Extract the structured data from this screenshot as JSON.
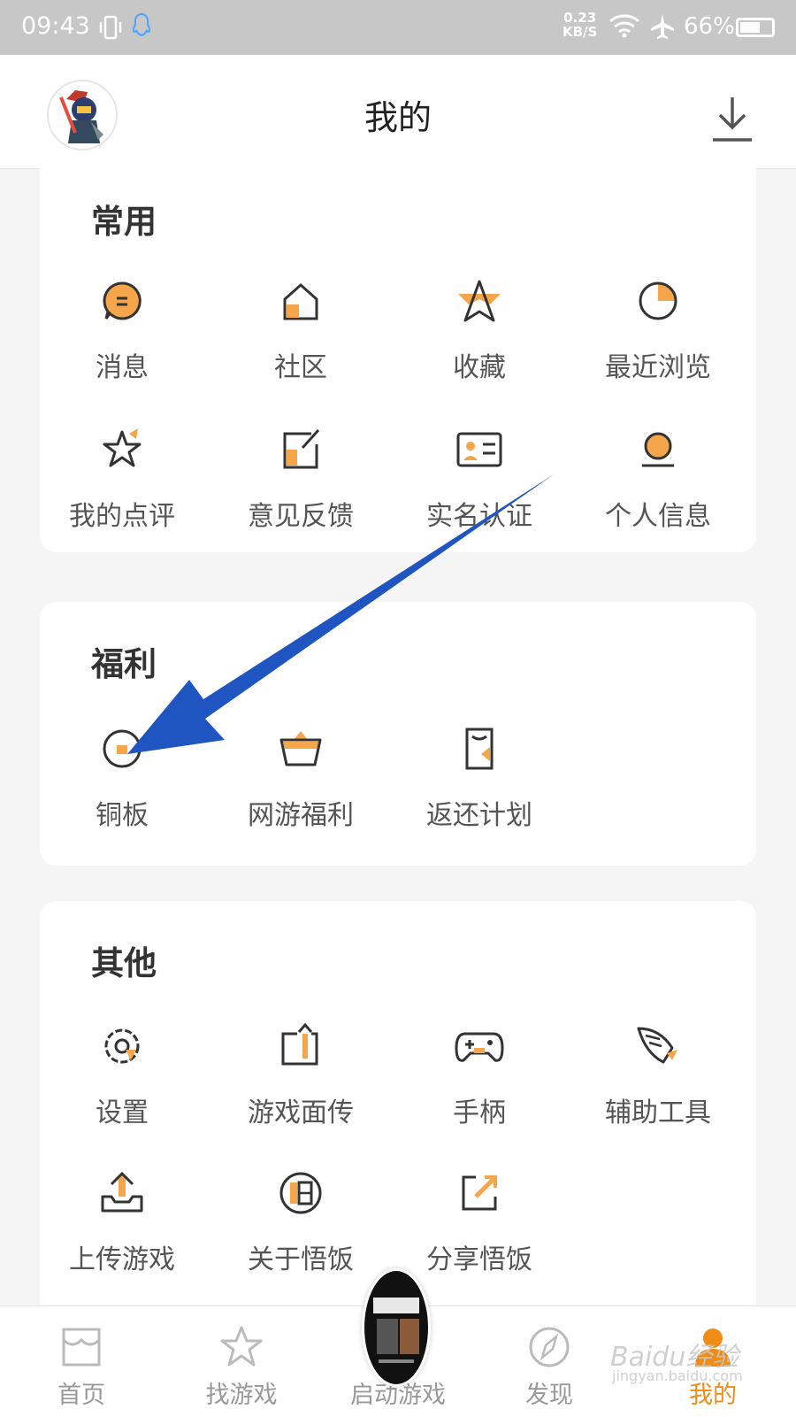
{
  "status_bar": {
    "time": "09:43",
    "speed_value": "0.23",
    "speed_unit": "KB/S",
    "battery": "66%",
    "battery_level": 0.66
  },
  "header": {
    "title": "我的"
  },
  "sections": {
    "common": {
      "title": "常用",
      "items": [
        "消息",
        "社区",
        "收藏",
        "最近浏览",
        "我的点评",
        "意见反馈",
        "实名认证",
        "个人信息"
      ]
    },
    "welfare": {
      "title": "福利",
      "items": [
        "铜板",
        "网游福利",
        "返还计划"
      ]
    },
    "other": {
      "title": "其他",
      "items": [
        "设置",
        "游戏面传",
        "手柄",
        "辅助工具",
        "上传游戏",
        "关于悟饭",
        "分享悟饭"
      ]
    }
  },
  "tabbar": {
    "tabs": [
      "首页",
      "找游戏",
      "启动游戏",
      "发现",
      "我的"
    ],
    "active": "我的"
  },
  "watermark": {
    "line1": "Baidu经验",
    "line2": "jingyan.baidu.com"
  },
  "colors": {
    "accent": "#f08c16",
    "arrow": "#1f55c0"
  }
}
